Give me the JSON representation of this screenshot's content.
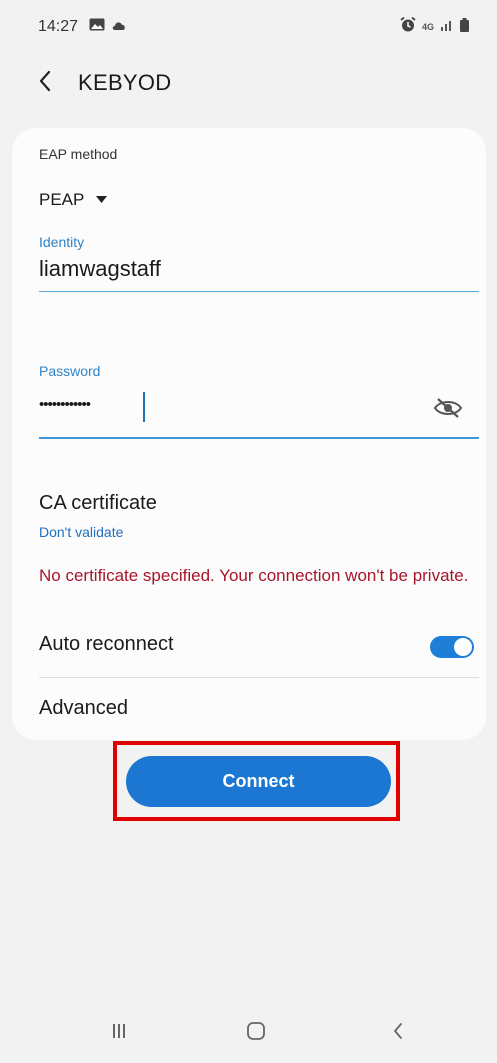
{
  "status_bar": {
    "time": "14:27",
    "network_label": "4G"
  },
  "header": {
    "title": "KEBYOD"
  },
  "form": {
    "eap_method_label": "EAP method",
    "eap_method_value": "PEAP",
    "identity_label": "Identity",
    "identity_value": "liamwagstaff",
    "password_label": "Password",
    "password_masked": "••••••••••••",
    "ca_certificate_label": "CA certificate",
    "ca_certificate_value": "Don't validate",
    "warning_text": "No certificate specified. Your connection won't be private.",
    "auto_reconnect_label": "Auto reconnect",
    "auto_reconnect_on": true,
    "advanced_label": "Advanced"
  },
  "actions": {
    "connect_label": "Connect"
  },
  "colors": {
    "accent": "#1b77d2",
    "label_blue": "#2f84c6",
    "warning": "#a8162a",
    "highlight": "#e00000"
  },
  "icons": {
    "back": "chevron-left-icon",
    "password_visibility": "eye-off-icon",
    "eap_dropdown": "caret-down-icon",
    "nav_recents": "recents-icon",
    "nav_home": "home-icon",
    "nav_back": "back-icon"
  }
}
